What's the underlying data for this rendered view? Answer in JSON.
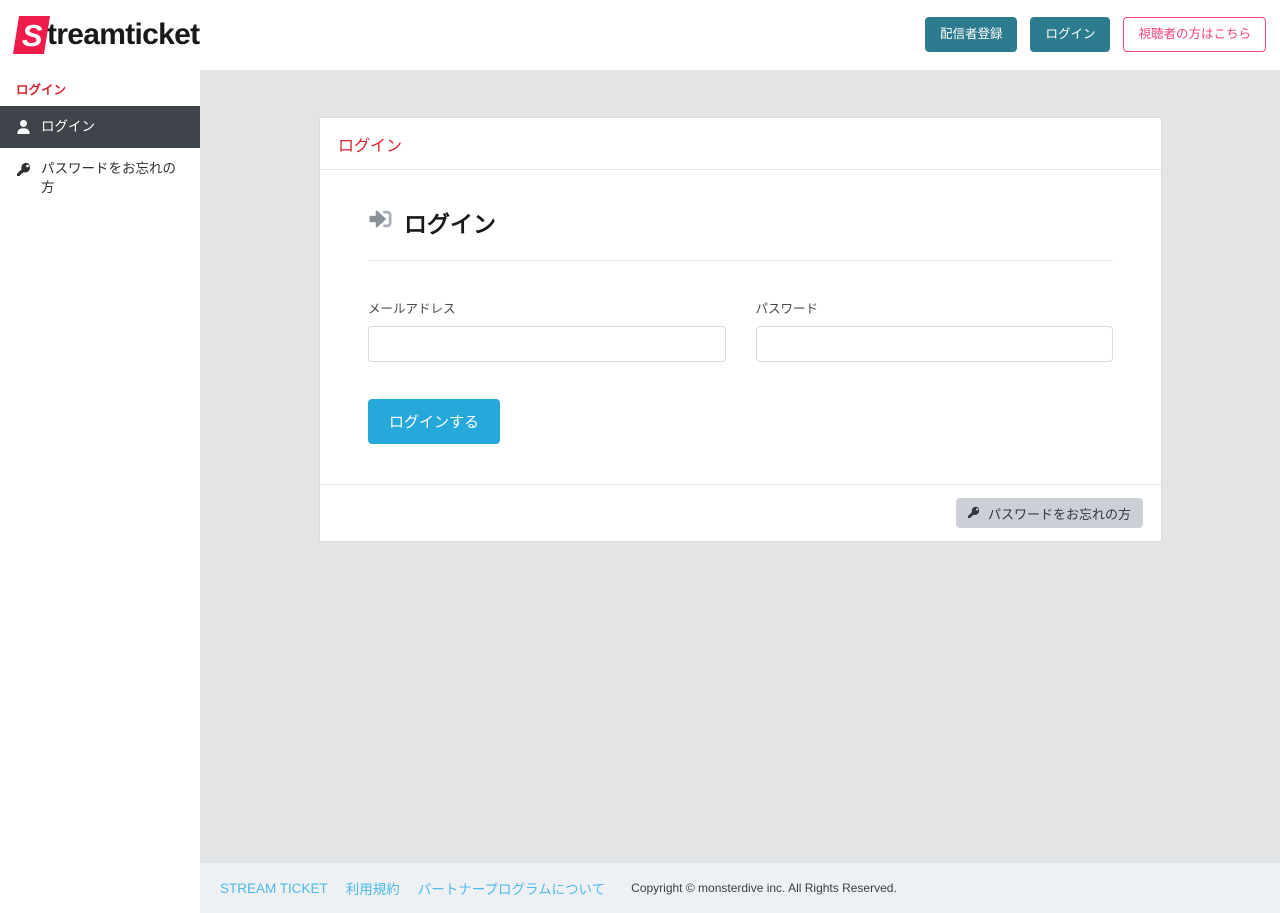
{
  "header": {
    "logo_mark_letter": "S",
    "logo_text": "treamticket",
    "buttons": [
      {
        "label": "配信者登録",
        "style": "teal",
        "name": "broadcaster-register-button"
      },
      {
        "label": "ログイン",
        "style": "teal",
        "name": "header-login-button"
      },
      {
        "label": "視聴者の方はこちら",
        "style": "pink-outline",
        "name": "viewer-link-button"
      }
    ]
  },
  "sidebar": {
    "title": "ログイン",
    "items": [
      {
        "label": "ログイン",
        "icon": "user-icon",
        "active": true
      },
      {
        "label": "パスワードをお忘れの方",
        "icon": "key-icon",
        "active": false
      }
    ]
  },
  "card": {
    "header_title": "ログイン",
    "panel_heading": "ログイン",
    "panel_heading_icon": "sign-in-icon",
    "fields": [
      {
        "label": "メールアドレス",
        "value": "",
        "placeholder": "",
        "type": "text",
        "name": "email-field"
      },
      {
        "label": "パスワード",
        "value": "",
        "placeholder": "",
        "type": "password",
        "name": "password-field"
      }
    ],
    "submit_label": "ログインする",
    "footer_button_label": "パスワードをお忘れの方",
    "footer_button_icon": "key-icon"
  },
  "footer": {
    "links": [
      {
        "label": "STREAM TICKET"
      },
      {
        "label": "利用規約"
      },
      {
        "label": "パートナープログラムについて"
      }
    ],
    "copyright": "Copyright © monsterdive inc. All Rights Reserved."
  },
  "colors": {
    "brand_red": "#ed1c4a",
    "accent_pink": "#f4447c",
    "teal": "#2d7b8e",
    "primary_blue": "#27a8db",
    "link_blue": "#4fb9e8",
    "sidebar_active": "#3e444a",
    "main_bg": "#e3e4e6"
  }
}
